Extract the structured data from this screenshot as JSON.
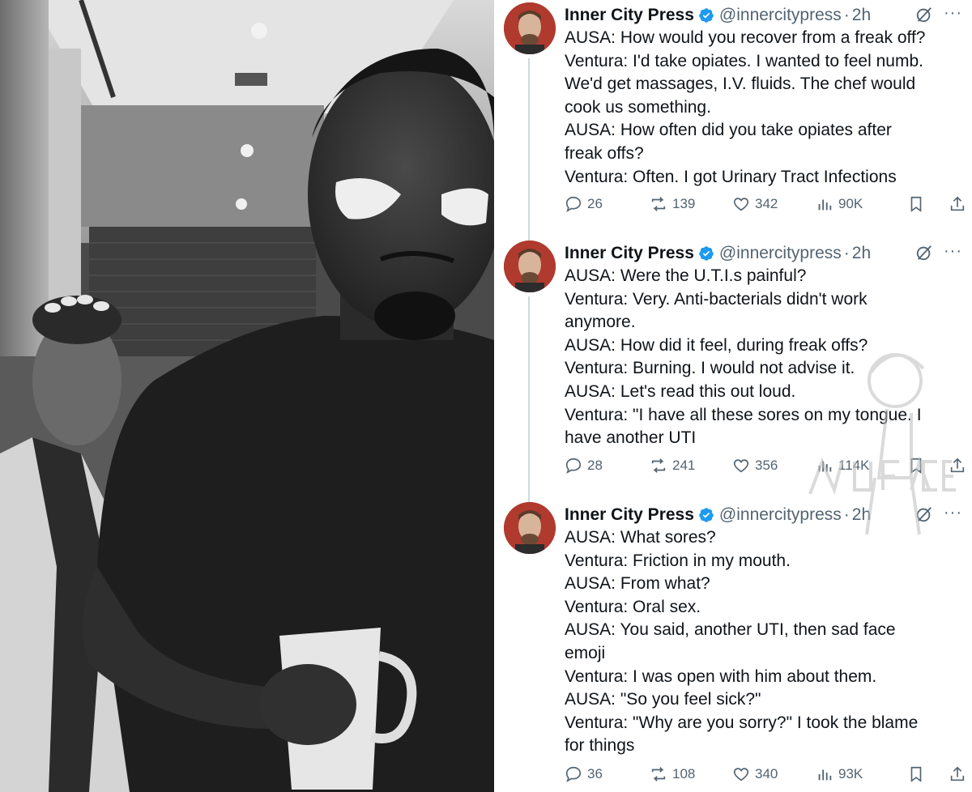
{
  "colors": {
    "name": "#0f1419",
    "muted": "#536471",
    "verified": "#1d9bf0",
    "thread_line": "#cfd9de"
  },
  "photo": {
    "description_icon": "photo-image"
  },
  "tweets": [
    {
      "author": "Inner City Press",
      "handle": "@innercitypress",
      "dot": "·",
      "time": "2h",
      "more": "···",
      "lines": [
        "AUSA: How would you recover from a freak off?",
        "Ventura: I'd take opiates. I wanted to feel numb.",
        "We'd get massages, I.V. fluids. The chef would",
        "cook us something.",
        "AUSA: How often did you take opiates after",
        "freak offs?",
        "Ventura: Often. I got Urinary Tract Infections"
      ],
      "replies": "26",
      "reposts": "139",
      "likes": "342",
      "views": "90K"
    },
    {
      "author": "Inner City Press",
      "handle": "@innercitypress",
      "dot": "·",
      "time": "2h",
      "more": "···",
      "lines": [
        "AUSA: Were the U.T.I.s painful?",
        "Ventura: Very. Anti-bacterials didn't work",
        "anymore.",
        "AUSA: How did it feel, during freak offs?",
        "Ventura: Burning. I would not advise it.",
        "AUSA: Let's read this out loud.",
        "Ventura: \"I have all these sores on my tongue. I",
        "have another UTI"
      ],
      "replies": "28",
      "reposts": "241",
      "likes": "356",
      "views": "114K"
    },
    {
      "author": "Inner City Press",
      "handle": "@innercitypress",
      "dot": "·",
      "time": "2h",
      "more": "···",
      "lines": [
        "AUSA: What sores?",
        "Ventura: Friction in my mouth.",
        "AUSA: From what?",
        "Ventura: Oral sex.",
        "AUSA: You said, another UTI, then sad face",
        "emoji",
        "Ventura: I was open with him about them.",
        "AUSA: \"So you feel sick?\"",
        "Ventura: \"Why are you sorry?\" I took the blame",
        "for things"
      ],
      "replies": "36",
      "reposts": "108",
      "likes": "340",
      "views": "93K"
    }
  ],
  "watermark": {
    "text": "NUFACE"
  }
}
